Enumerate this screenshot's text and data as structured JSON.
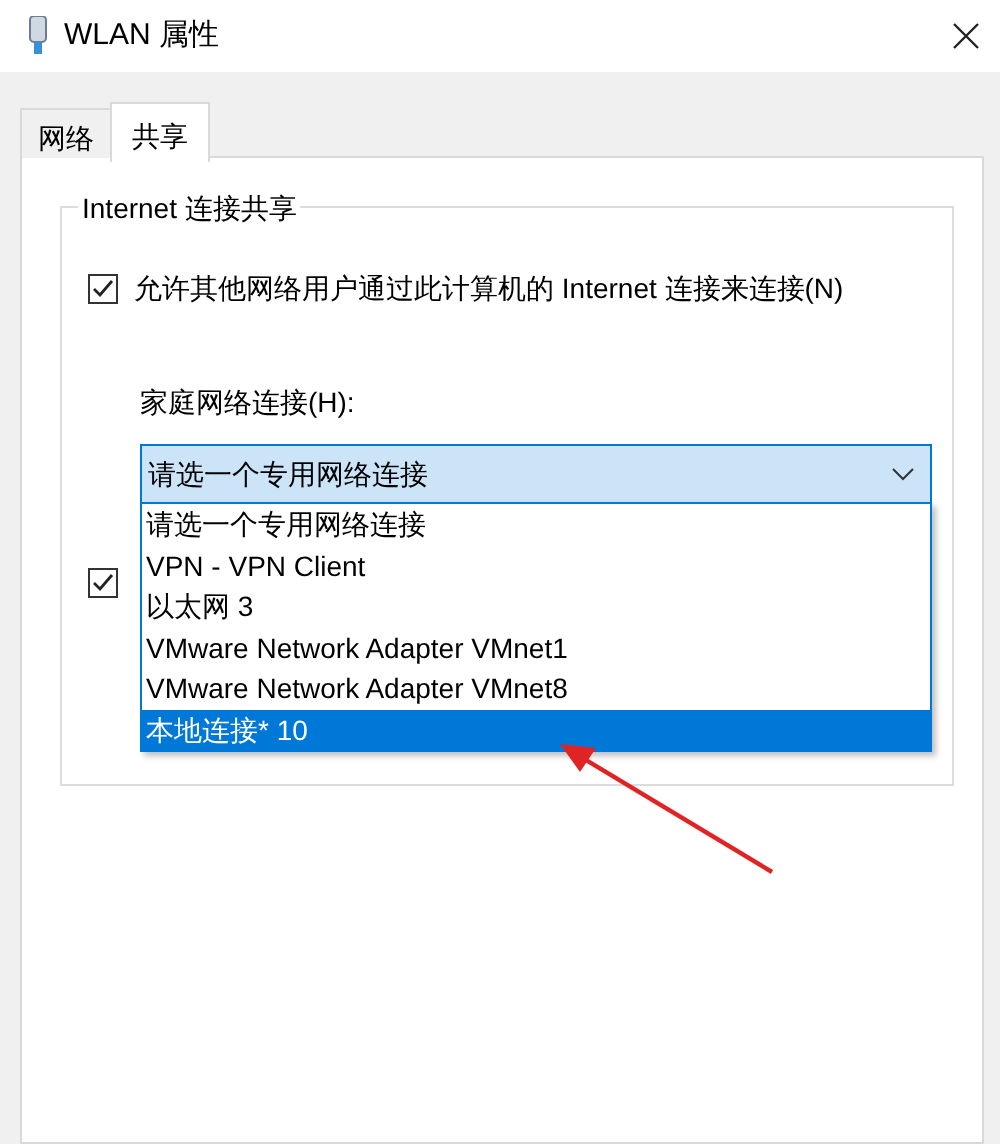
{
  "window": {
    "title": "WLAN 属性"
  },
  "tabs": [
    {
      "label": "网络",
      "selected": false
    },
    {
      "label": "共享",
      "selected": true
    }
  ],
  "sharing_group": {
    "title": "Internet 连接共享",
    "allow_sharing": {
      "label": "允许其他网络用户通过此计算机的 Internet 连接来连接(N)",
      "checked": true
    },
    "home_network": {
      "label": "家庭网络连接(H):",
      "value": "请选一个专用网络连接",
      "expanded": true,
      "options": [
        {
          "label": "请选一个专用网络连接",
          "highlighted": false
        },
        {
          "label": "VPN - VPN Client",
          "highlighted": false
        },
        {
          "label": "以太网 3",
          "highlighted": false
        },
        {
          "label": "VMware Network Adapter VMnet1",
          "highlighted": false
        },
        {
          "label": "VMware Network Adapter VMnet8",
          "highlighted": false
        },
        {
          "label": "本地连接* 10",
          "highlighted": true
        }
      ]
    },
    "second_checkbox": {
      "checked": true
    }
  },
  "annotations": [
    {
      "kind": "arrow"
    }
  ]
}
